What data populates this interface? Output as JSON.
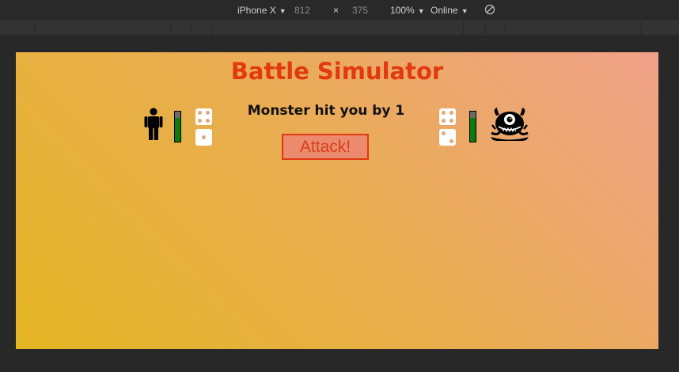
{
  "devtools": {
    "device": "iPhone X",
    "width": "812",
    "times": "×",
    "height": "375",
    "zoom": "100%",
    "network": "Online"
  },
  "game": {
    "title": "Battle Simulator",
    "message": "Monster hit you by 1",
    "attack_label": "Attack!",
    "player": {
      "health_fraction": 0.8,
      "dice": [
        4,
        1
      ]
    },
    "monster": {
      "health_fraction": 0.8,
      "dice": [
        4,
        2
      ]
    }
  },
  "colors": {
    "title": "#e2390f",
    "health_fill": "#0e7a0e",
    "button_bg": "#ec8a6e",
    "gradient_start": "#e4b523",
    "gradient_end": "#f0a28a"
  }
}
